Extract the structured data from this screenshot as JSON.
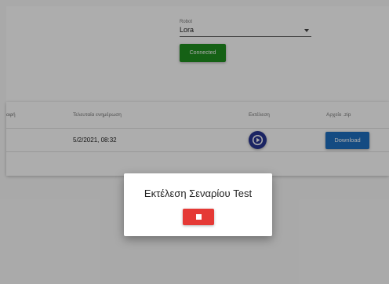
{
  "robot_panel": {
    "label": "Robot",
    "selected": "Lora",
    "status": "Connected"
  },
  "table": {
    "columns": [
      "αφή",
      "Τελευταία ενημέρωση",
      "Εκτέλεση",
      "Αρχείο .zip"
    ],
    "rows": [
      {
        "last_update": "5/2/2021, 08:32",
        "download_label": "Download"
      }
    ]
  },
  "modal": {
    "title": "Εκτέλεση Σεναρίου Test",
    "stop_icon": "stop-icon"
  },
  "colors": {
    "connected": "#1f8f1f",
    "download": "#1e6fc0",
    "execute": "#283593",
    "stop": "#e53935"
  }
}
